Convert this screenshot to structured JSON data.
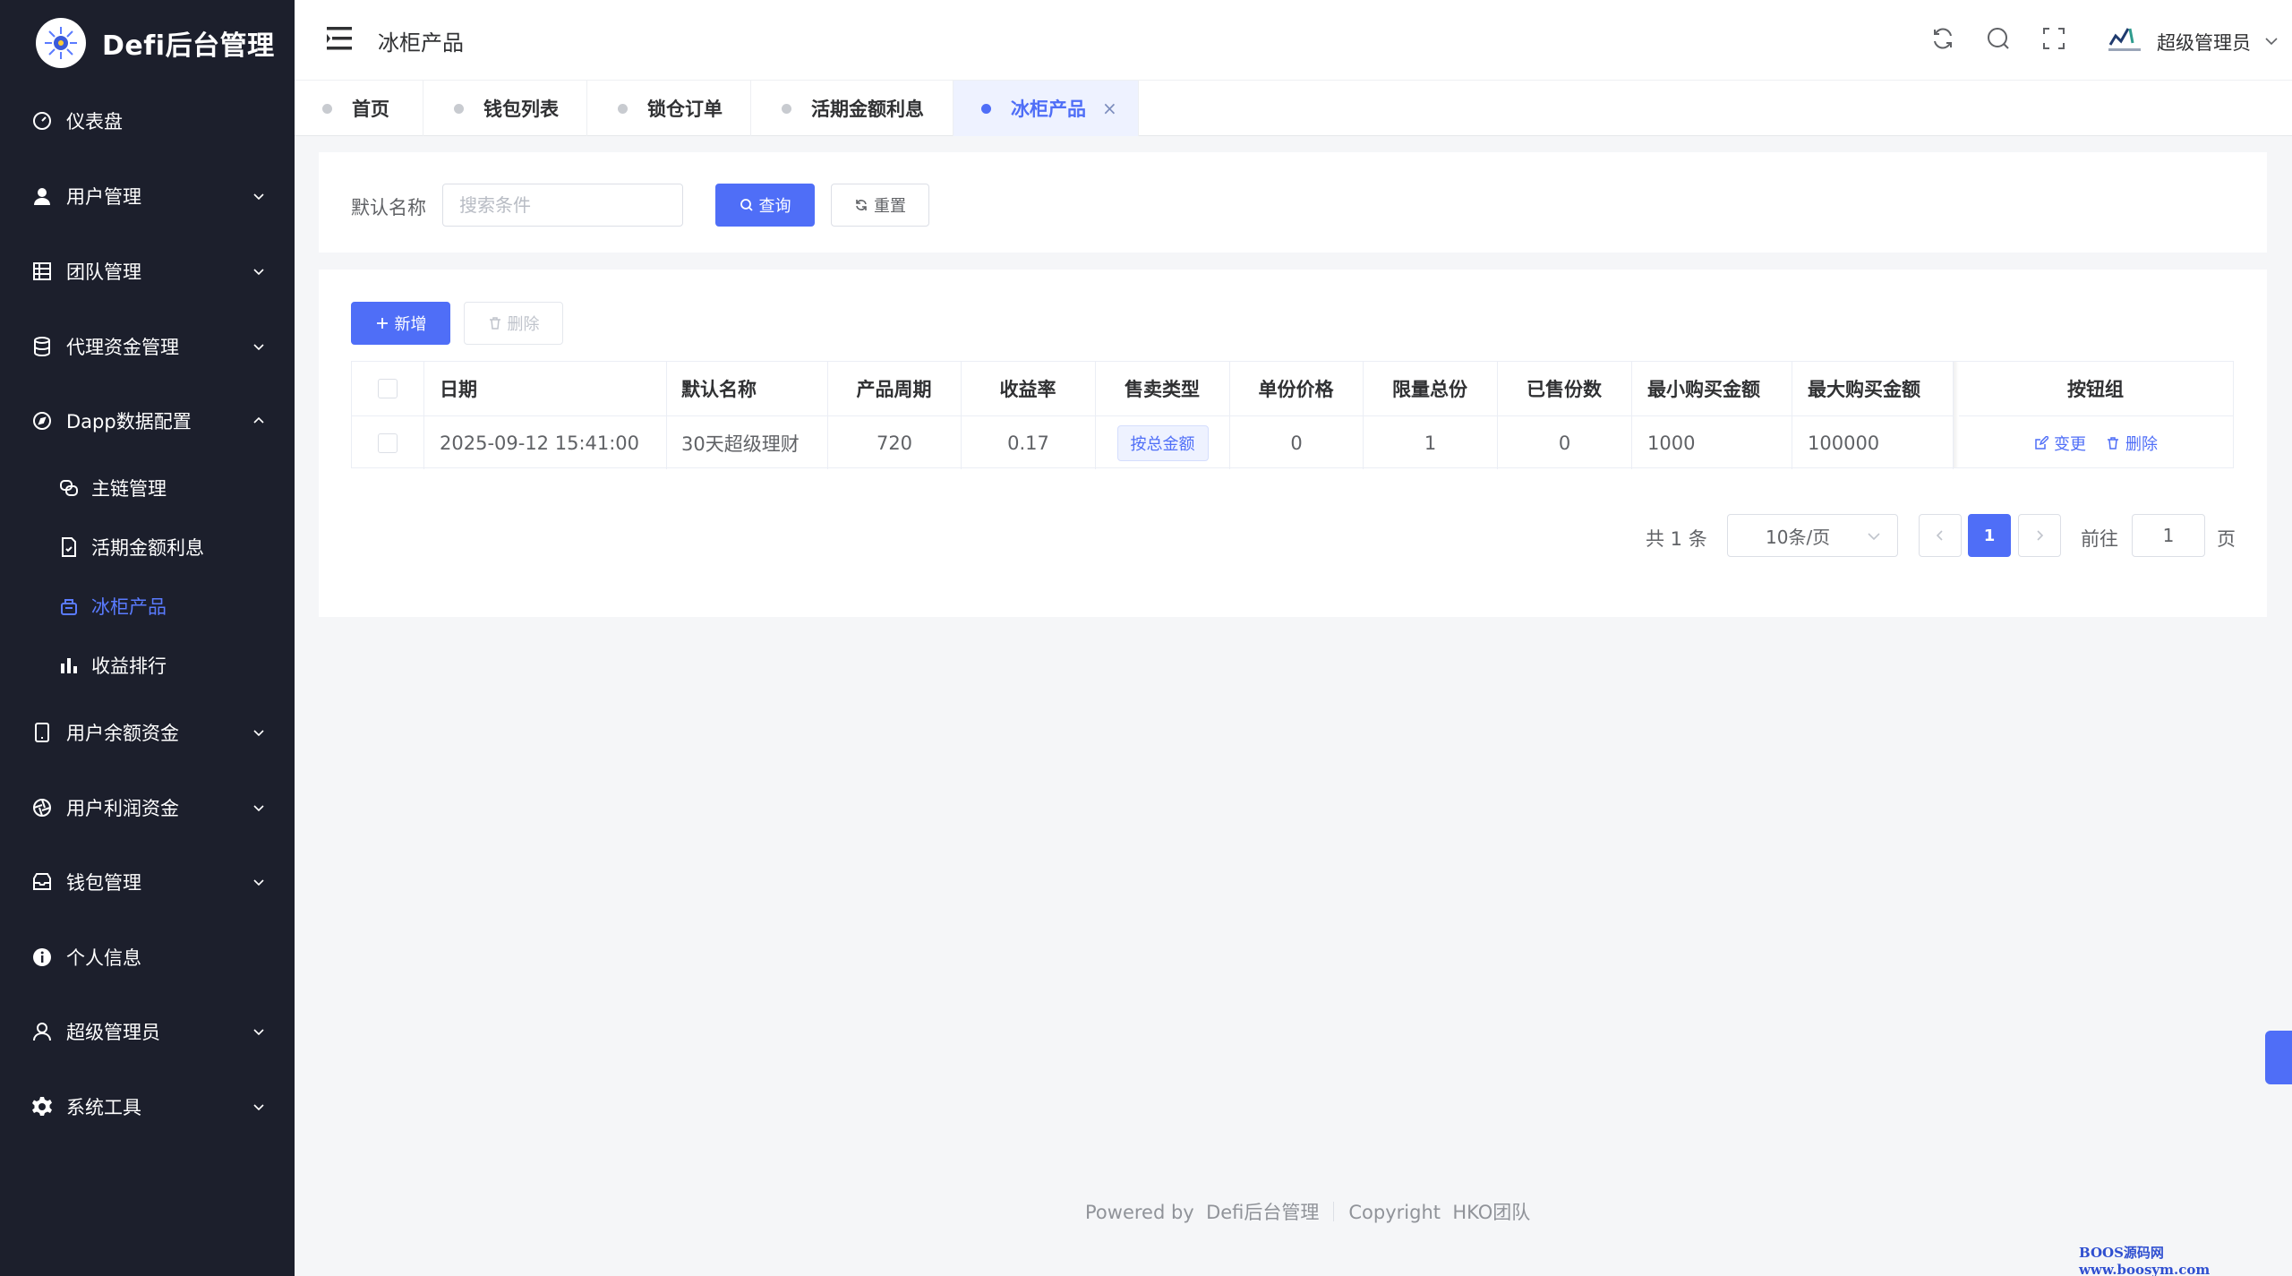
{
  "app": {
    "title": "Defi后台管理"
  },
  "sidebar": {
    "items": [
      {
        "label": "仪表盘",
        "icon": "dashboard-icon"
      },
      {
        "label": "用户管理",
        "icon": "user-icon"
      },
      {
        "label": "团队管理",
        "icon": "grid-icon"
      },
      {
        "label": "代理资金管理",
        "icon": "database-icon"
      },
      {
        "label": "Dapp数据配置",
        "icon": "compass-icon"
      },
      {
        "label": "用户余额资金",
        "icon": "tablet-icon"
      },
      {
        "label": "用户利润资金",
        "icon": "aperture-icon"
      },
      {
        "label": "钱包管理",
        "icon": "wallet-icon"
      },
      {
        "label": "个人信息",
        "icon": "info-icon"
      },
      {
        "label": "超级管理员",
        "icon": "admin-icon"
      },
      {
        "label": "系统工具",
        "icon": "gear-icon"
      }
    ],
    "sub_items": [
      {
        "label": "主链管理",
        "icon": "chain-icon"
      },
      {
        "label": "活期金额利息",
        "icon": "document-icon"
      },
      {
        "label": "冰柜产品",
        "icon": "box-icon"
      },
      {
        "label": "收益排行",
        "icon": "bar-chart-icon"
      }
    ]
  },
  "header": {
    "title": "冰柜产品",
    "user": "超级管理员"
  },
  "tabs": [
    {
      "label": "首页"
    },
    {
      "label": "钱包列表"
    },
    {
      "label": "锁仓订单"
    },
    {
      "label": "活期金额利息"
    },
    {
      "label": "冰柜产品",
      "close": "×"
    }
  ],
  "search": {
    "label": "默认名称",
    "placeholder": "搜索条件",
    "query_label": "查询",
    "reset_label": "重置"
  },
  "toolbar": {
    "add_label": "新增",
    "delete_label": "删除"
  },
  "table": {
    "columns": [
      "日期",
      "默认名称",
      "产品周期",
      "收益率",
      "售卖类型",
      "单份价格",
      "限量总份",
      "已售份数",
      "最小购买金额",
      "最大购买金额",
      "按钮组"
    ],
    "rows": [
      {
        "date": "2025-09-12 15:41:00",
        "name": "30天超级理财",
        "period": "720",
        "rate": "0.17",
        "sale_type": "按总金额",
        "unit_price": "0",
        "limit_total": "1",
        "sold": "0",
        "min_amount": "1000",
        "max_amount": "100000",
        "edit_label": "变更",
        "delete_label": "删除"
      }
    ]
  },
  "pagination": {
    "total": "共 1 条",
    "page_size": "10条/页",
    "current": "1",
    "goto_label": "前往",
    "goto_value": "1",
    "page_suffix": "页"
  },
  "footer": {
    "powered": "Powered by  Defi后台管理",
    "copyright": "Copyright  HKO团队"
  },
  "watermark": "BOOS源码网www.boosym.com",
  "colors": {
    "accent": "#4f6ef7",
    "sidebar_bg": "#1c1f2c"
  }
}
